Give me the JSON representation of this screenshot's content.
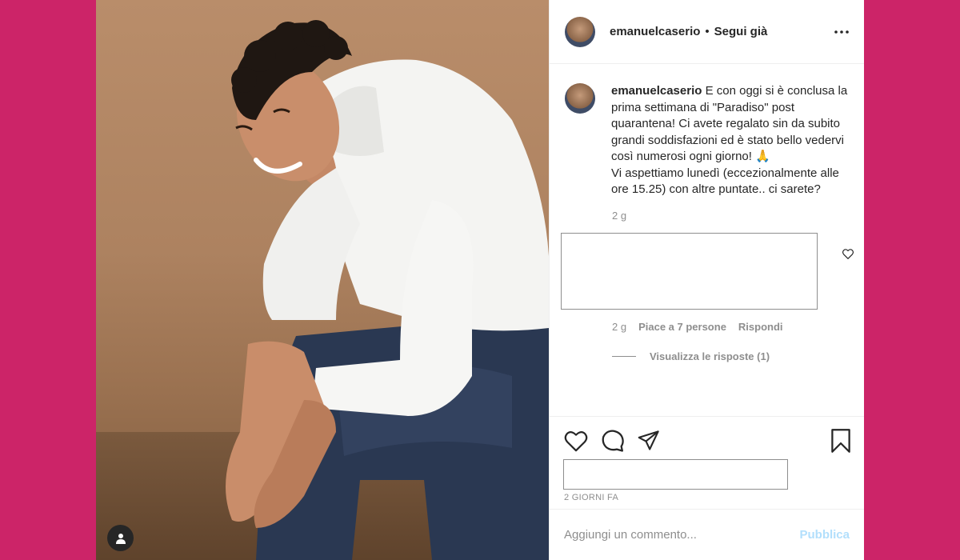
{
  "colors": {
    "page_background": "#cc2468",
    "text": "#262626",
    "secondary_text": "#8e8e8e",
    "publish_disabled": "#b2dffc"
  },
  "header": {
    "username": "emanuelcaserio",
    "separator": "•",
    "follow_status": "Segui già",
    "more_icon": "more-horizontal-icon"
  },
  "caption": {
    "username": "emanuelcaserio",
    "text": "E con oggi si è conclusa la prima settimana di \"Paradiso\" post quarantena! Ci avete regalato sin da subito grandi soddisfazioni ed è stato bello vedervi così numerosi ogni giorno! 🙏\nVi aspettiamo lunedì (eccezionalmente alle ore 15.25) con altre puntate.. ci sarete?",
    "time": "2 g"
  },
  "reply": {
    "time": "2 g",
    "likes": "Piace a 7 persone",
    "reply_label": "Rispondi",
    "view_replies": "Visualizza le risposte (1)"
  },
  "actions": {
    "icons": [
      "heart-icon",
      "comment-icon",
      "share-icon",
      "bookmark-icon"
    ],
    "timestamp": "2 GIORNI FA"
  },
  "add_comment": {
    "placeholder": "Aggiungi un commento...",
    "publish_label": "Pubblica"
  }
}
